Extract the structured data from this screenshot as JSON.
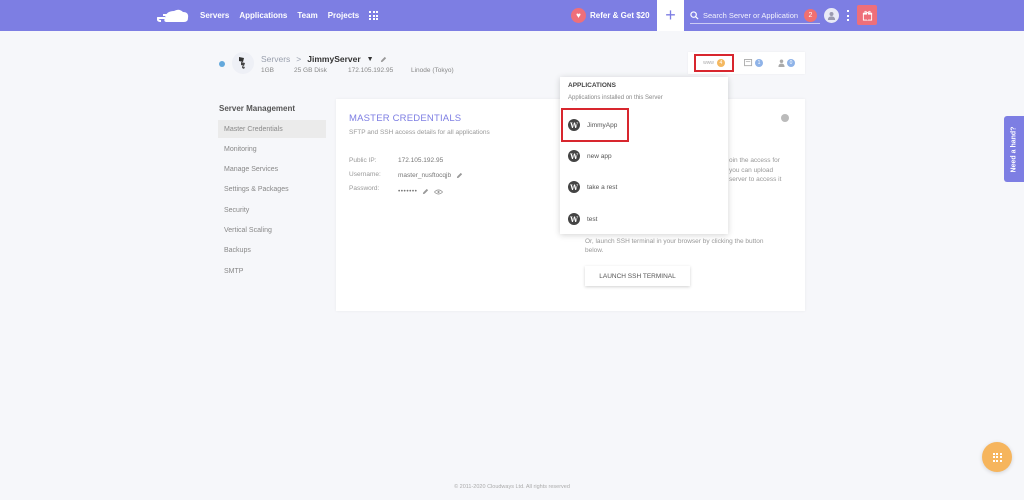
{
  "topbar": {
    "nav": [
      "Servers",
      "Applications",
      "Team",
      "Projects"
    ],
    "refer_label": "Refer & Get $20",
    "add_label": "+",
    "search_placeholder": "Search Server or Application",
    "notification_count": "2"
  },
  "server": {
    "crumb_root": "Servers",
    "crumb_sep": ">",
    "name": "JimmyServer",
    "caret": "▼",
    "ram": "1GB",
    "disk": "25 GB Disk",
    "ip": "172.105.192.95",
    "provider": "Linode (Tokyo)"
  },
  "tabs": {
    "www_label": "www",
    "www_count": "4",
    "files_count": "1",
    "users_count": "0"
  },
  "sidebar": {
    "title": "Server Management",
    "items": [
      {
        "label": "Master Credentials",
        "active": true
      },
      {
        "label": "Monitoring"
      },
      {
        "label": "Manage Services"
      },
      {
        "label": "Settings & Packages"
      },
      {
        "label": "Security"
      },
      {
        "label": "Vertical Scaling"
      },
      {
        "label": "Backups"
      },
      {
        "label": "SMTP"
      }
    ]
  },
  "card": {
    "title": "MASTER CREDENTIALS",
    "subtitle": "SFTP and SSH access details for all applications",
    "fields": [
      {
        "label": "Public IP:",
        "value": "172.105.192.95"
      },
      {
        "label": "Username:",
        "value": "master_nusftocqjb"
      },
      {
        "label": "Password:",
        "value": "•••••••"
      }
    ],
    "right_lines": [
      "oin the access for",
      "you can upload",
      "server to access it"
    ],
    "ssh_note_1": "Or, launch SSH terminal in your browser by clicking the button",
    "ssh_note_2": "below.",
    "ssh_button": "LAUNCH SSH TERMINAL"
  },
  "dropdown": {
    "heading": "APPLICATIONS",
    "subheading": "Applications installed on this Server",
    "apps": [
      "JimmyApp",
      "new app",
      "take a rest",
      "test"
    ]
  },
  "side_tab": "Need a hand?",
  "footer": "© 2011-2020 Cloudways Ltd. All rights reserved",
  "colors": {
    "brand": "#7d7ee3",
    "highlight": "#d8262e",
    "fab": "#f6b55d",
    "accent_pink": "#ee6f7a"
  }
}
